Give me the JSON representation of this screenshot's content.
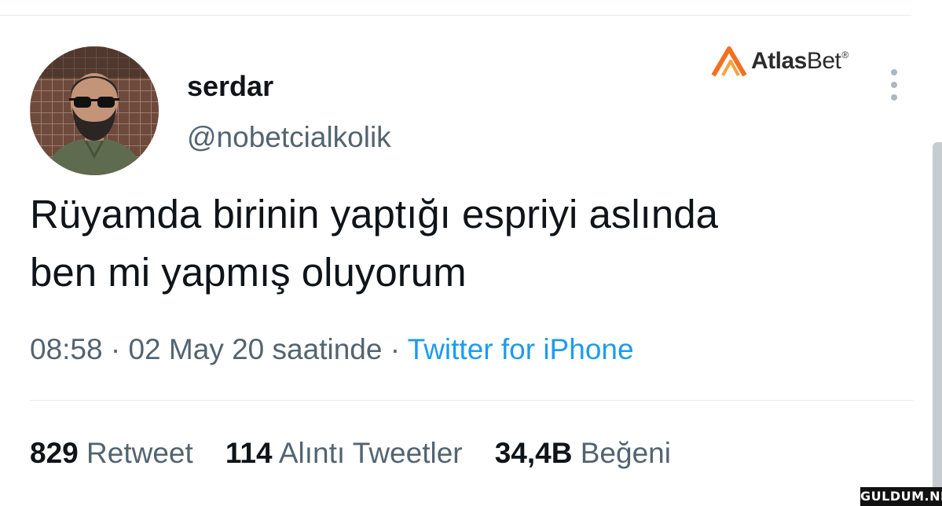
{
  "tweet": {
    "author": {
      "display_name": "serdar",
      "handle": "@nobetcialkolik",
      "avatar": "profile-photo"
    },
    "text": "Rüyamda birinin yaptığı espriyi aslında\nben mi yapmış oluyorum",
    "time": "08:58",
    "date": "02 May 20 saatinde",
    "separator": " · ",
    "source": "Twitter for iPhone",
    "stats": {
      "retweets_count": "829",
      "retweets_label": "Retweet",
      "quotes_count": "114",
      "quotes_label": "Alıntı Tweetler",
      "likes_count": "34,4B",
      "likes_label": "Beğeni"
    }
  },
  "overlay": {
    "brand_part1": "Atlas",
    "brand_part2": "Bet",
    "brand_mark": "®",
    "watermark": "GULDUM.NET"
  },
  "icons": {
    "more": "more-vertical-icon",
    "brand": "atlasbet-logo-icon"
  },
  "colors": {
    "text_primary": "#0f1419",
    "text_secondary": "#536471",
    "link": "#1d9bf0",
    "brand_orange": "#f37021"
  }
}
